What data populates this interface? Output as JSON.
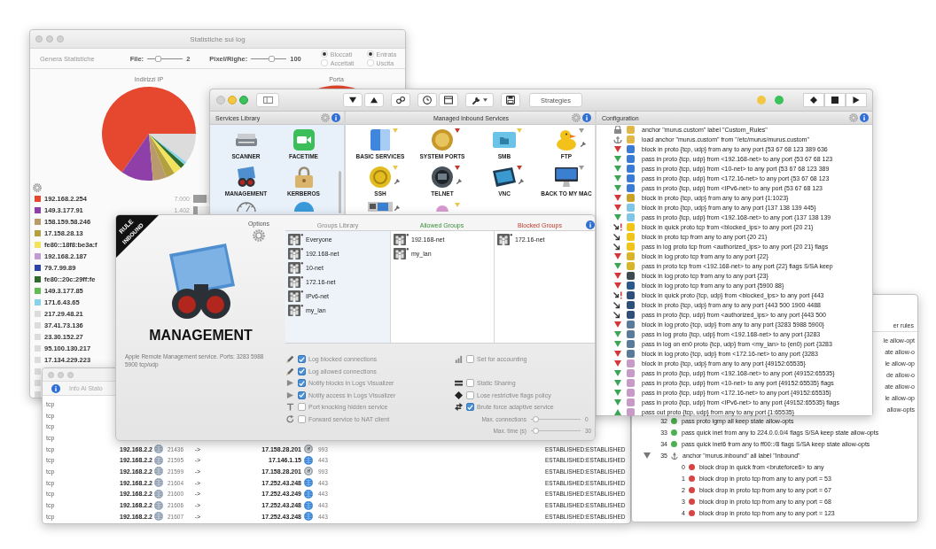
{
  "stats_window": {
    "title": "Statistiche sui log",
    "generate_label": "Genera Statistiche",
    "sliders": [
      {
        "label": "File:",
        "level": 0.27,
        "value": "2"
      },
      {
        "label": "Pixel/Righe:",
        "level": 0.6,
        "value": "100"
      }
    ],
    "radio_groups": [
      [
        {
          "label": "Bloccati",
          "selected": true
        },
        {
          "label": "Accettati",
          "selected": false
        }
      ],
      [
        {
          "label": "Entrata",
          "selected": true
        },
        {
          "label": "Uscita",
          "selected": false
        }
      ]
    ],
    "ip_chart": {
      "title": "Indirizzi IP"
    },
    "port_chart": {
      "title": "Porta"
    },
    "legend": [
      {
        "label": "192.168.2.254",
        "color": "#e5472f",
        "value": "7.000",
        "level": 0.85
      },
      {
        "label": "149.3.177.91",
        "color": "#8e3fa8",
        "value": "1.402",
        "level": 0.3
      },
      {
        "label": "158.159.58.246",
        "color": "#b89a6c"
      },
      {
        "label": "17.158.28.13",
        "color": "#b3a040"
      },
      {
        "label": "fe80::18f8:be3a:f",
        "color": "#f2e25c"
      },
      {
        "label": "192.168.2.187",
        "color": "#c39bd3"
      },
      {
        "label": "79.7.99.89",
        "color": "#2b44a6"
      },
      {
        "label": "fe80::20c:29ff:fe",
        "color": "#2e6b2e"
      },
      {
        "label": "149.3.177.85",
        "color": "#62bb55"
      },
      {
        "label": "171.6.43.65",
        "color": "#86d3e8"
      },
      {
        "label": "217.29.48.21",
        "color": "#dcdcdc"
      },
      {
        "label": "37.41.73.136",
        "color": "#dcdcdc"
      },
      {
        "label": "23.30.152.27",
        "color": "#dcdcdc"
      },
      {
        "label": "95.100.130.217",
        "color": "#dcdcdc"
      },
      {
        "label": "17.134.229.223",
        "color": "#dcdcdc"
      },
      {
        "color": "#dcdcdc"
      },
      {
        "color": "#dcdcdc"
      },
      {
        "color": "#dcdcdc"
      }
    ]
  },
  "main_window": {
    "toolbar": {
      "strategies_label": "Strategies"
    },
    "status_lights": [
      {
        "color": "#f2c744"
      },
      {
        "color": "#3cc25a"
      }
    ],
    "services_library": {
      "title": "Services Library",
      "items": [
        {
          "label": "SCANNER"
        },
        {
          "label": "FACETIME"
        },
        {
          "label": "MANAGEMENT"
        },
        {
          "label": "KERBEROS"
        }
      ]
    },
    "managed_services": {
      "title": "Managed Inbound Services",
      "items": [
        {
          "label": "BASIC SERVICES",
          "color": "#e9c84f"
        },
        {
          "label": "SYSTEM PORTS",
          "color": "#c0392b"
        },
        {
          "label": "SMB",
          "color": "#e9c84f"
        },
        {
          "label": "FTP",
          "color": "#9a9a9a",
          "configured": true
        },
        {
          "label": "SSH",
          "color": "#e9c84f",
          "configured": true
        },
        {
          "label": "TELNET",
          "color": "#c0392b",
          "configured": true
        },
        {
          "label": "VNC",
          "color": "#c0392b",
          "configured": true
        },
        {
          "label": "BACK TO MY MAC",
          "color": "#9a9a9a"
        },
        {
          "configured": true
        },
        {
          "color": "#e9c84f"
        }
      ]
    },
    "configuration": {
      "title": "Configuration",
      "lines": [
        {
          "kind": "lock",
          "color": "#e0b84a",
          "text": "anchor \"murus.custom\" label \"Custom_Rules\""
        },
        {
          "kind": "anchor",
          "color": "#e0b84a",
          "text": "load anchor \"murus.custom\" from \"/etc/murus/murus.custom\""
        },
        {
          "kind": "block",
          "color": "#3a7bd5",
          "text": "block in proto {tcp, udp} from any to any port {53 67 68 123 389 636"
        },
        {
          "kind": "pass",
          "color": "#3a7bd5",
          "text": "pass in proto {tcp, udp} from <192.168-net> to any port {53 67 68 123"
        },
        {
          "kind": "pass",
          "color": "#3a7bd5",
          "text": "pass in proto {tcp, udp} from <10-net> to any port {53 67 68 123 389"
        },
        {
          "kind": "pass",
          "color": "#3a7bd5",
          "text": "pass in proto {tcp, udp} from <172.16-net> to any port {53 67 68 123"
        },
        {
          "kind": "pass",
          "color": "#3a7bd5",
          "text": "pass in proto {tcp, udp} from <IPv6-net> to any port {53 67 68 123"
        },
        {
          "kind": "block",
          "color": "#c9a227",
          "text": "block in proto {tcp, udp} from any to any port {1:1023}"
        },
        {
          "kind": "block",
          "color": "#7fc6e6",
          "text": "block in proto {tcp, udp} from any to any port {137 138 139 445}"
        },
        {
          "kind": "pass",
          "color": "#7fc6e6",
          "text": "pass in proto {tcp, udp} from <192.168-net> to any port {137 138 139"
        },
        {
          "kind": "quick",
          "color": "#f0c419",
          "text": "block in quick proto tcp from <blocked_ips> to any port {20 21}"
        },
        {
          "kind": "arrow",
          "color": "#f0c419",
          "text": "block in proto tcp from any to any port {20 21}"
        },
        {
          "kind": "arrow",
          "color": "#f0c419",
          "text": "pass in log proto tcp from <authorized_ips> to any port {20 21} flags"
        },
        {
          "kind": "block",
          "color": "#d8b42a",
          "text": "block in log proto tcp from any to any port {22}"
        },
        {
          "kind": "pass",
          "color": "#d8b42a",
          "text": "pass in proto tcp from <192.168-net> to any port {22} flags S/SA keep"
        },
        {
          "kind": "block",
          "color": "#3c4a52",
          "text": "block in log proto tcp from any to any port {23}"
        },
        {
          "kind": "block",
          "color": "#2b5a8a",
          "text": "block in log proto tcp from any to any port {5900 88}"
        },
        {
          "kind": "quick",
          "color": "#2e4f7a",
          "text": "block in quick proto {tcp, udp} from <blocked_ips> to any port {443"
        },
        {
          "kind": "arrow",
          "color": "#2e4f7a",
          "text": "block in proto {tcp, udp} from any to any port {443 500 1900 4488"
        },
        {
          "kind": "arrow",
          "color": "#2e4f7a",
          "text": "pass in proto {tcp, udp} from <authorized_ips> to any port {443 500"
        },
        {
          "kind": "block",
          "color": "#5a7a9a",
          "text": "block in log proto {tcp, udp} from any to any port {3283 5988 5900}"
        },
        {
          "kind": "pass",
          "color": "#5a7a9a",
          "text": "pass in log proto {tcp, udp} from <192.168-net> to any port {3283"
        },
        {
          "kind": "pass",
          "color": "#5a7a9a",
          "text": "pass in log on en0 proto {tcp, udp} from <my_lan> to (en0) port {3283"
        },
        {
          "kind": "block",
          "color": "#5a7a9a",
          "text": "block in log proto {tcp, udp} from <172.16-net> to any port {3283"
        },
        {
          "kind": "block",
          "color": "#c89ac8",
          "text": "block in proto {tcp, udp} from any to any port {49152:65535}"
        },
        {
          "kind": "pass",
          "color": "#c89ac8",
          "text": "pass in proto {tcp, udp} from <192.168-net> to any port {49152:65535}"
        },
        {
          "kind": "pass",
          "color": "#c89ac8",
          "text": "pass in proto {tcp, udp} from <10-net> to any port {49152:65535} flags"
        },
        {
          "kind": "pass",
          "color": "#c89ac8",
          "text": "pass in proto {tcp, udp} from <172.16-net> to any port {49152:65535}"
        },
        {
          "kind": "pass",
          "color": "#c89ac8",
          "text": "pass in proto {tcp, udp} from <IPv6-net> to any port {49152:65535} flags"
        },
        {
          "kind": "out",
          "color": "#c89ac8",
          "text": "pass out proto {tcp, udp} from any to any port {1:65535}"
        }
      ]
    }
  },
  "service_dialog": {
    "ribbon": [
      "RULE",
      "INBOUND"
    ],
    "options_label": "Options",
    "name": "MANAGEMENT",
    "description": "Apple Remote Management service. Ports: 3283 5988 5900 tcp/udp",
    "groups_library": {
      "title": "Groups Library",
      "items": [
        "Everyone",
        "192.168-net",
        "10-net",
        "172.16-net",
        "IPv6-net",
        "my_lan"
      ]
    },
    "allowed_groups": {
      "title": "Allowed Groups",
      "items": [
        "192.168-net",
        "my_lan"
      ]
    },
    "blocked_groups": {
      "title": "Blocked Groups",
      "items": [
        "172.16-net"
      ]
    },
    "left_options": [
      {
        "label": "Log blocked connections",
        "checked": true
      },
      {
        "label": "Log allowed connections",
        "checked": true
      },
      {
        "label": "Notify blocks in Logs Visualizer",
        "checked": true
      },
      {
        "label": "Notify access in Logs Visualizer",
        "checked": true
      },
      {
        "label": "Port knocking hidden service",
        "checked": false
      },
      {
        "label": "Forward service to NAT client",
        "checked": false
      }
    ],
    "right_options": [
      {
        "kind": "checkbox",
        "label": "Set for accounting",
        "checked": false
      },
      {
        "kind": "checkbox",
        "label": "Static Sharing",
        "checked": false
      },
      {
        "kind": "checkbox",
        "label": "Lose restrictive flags policy",
        "checked": false
      },
      {
        "kind": "checkbox",
        "label": "Brute force adaptive service",
        "checked": true
      },
      {
        "kind": "slider",
        "label": "Max. connections",
        "level": 0.05,
        "value": "0"
      },
      {
        "kind": "slider",
        "label": "Max. time (s)",
        "level": 0.05,
        "value": "30"
      }
    ]
  },
  "connections_window": {
    "info_text": "Info Al Stato",
    "rows": [
      {
        "protocol": "tcp"
      },
      {
        "protocol": "tcp"
      },
      {
        "protocol": "tcp"
      },
      {
        "protocol": "tcp"
      },
      {
        "protocol": "tcp",
        "source": "192.168.2.2",
        "source_port": "21436",
        "direction": "->",
        "destination": "17.158.28.201",
        "kind": "dial",
        "destination_port": "993",
        "state": "ESTABLISHED:ESTABLISHED"
      },
      {
        "protocol": "tcp",
        "source": "192.168.2.2",
        "source_port": "21595",
        "direction": "->",
        "destination": "17.146.1.15",
        "kind": "globe",
        "destination_port": "443",
        "state": "ESTABLISHED:ESTABLISHED"
      },
      {
        "protocol": "tcp",
        "source": "192.168.2.2",
        "source_port": "21599",
        "direction": "->",
        "destination": "17.158.28.201",
        "kind": "dial",
        "destination_port": "993",
        "state": "ESTABLISHED:ESTABLISHED"
      },
      {
        "protocol": "tcp",
        "source": "192.168.2.2",
        "source_port": "21604",
        "direction": "->",
        "destination": "17.252.43.248",
        "kind": "globe",
        "destination_port": "443",
        "state": "ESTABLISHED:ESTABLISHED"
      },
      {
        "protocol": "tcp",
        "source": "192.168.2.2",
        "source_port": "21600",
        "direction": "->",
        "destination": "17.252.43.249",
        "kind": "globe",
        "destination_port": "443",
        "state": "ESTABLISHED:ESTABLISHED"
      },
      {
        "protocol": "tcp",
        "source": "192.168.2.2",
        "source_port": "21606",
        "direction": "->",
        "destination": "17.252.43.248",
        "kind": "globe",
        "destination_port": "443",
        "state": "ESTABLISHED:ESTABLISHED"
      },
      {
        "protocol": "tcp",
        "source": "192.168.2.2",
        "source_port": "21607",
        "direction": "->",
        "destination": "17.252.43.248",
        "kind": "globe",
        "destination_port": "443",
        "state": "ESTABLISHED:ESTABLISHED"
      }
    ]
  },
  "rules_window": {
    "header_fragment": "er rules",
    "fragments": [
      "le allow-opt",
      "ate allow-o",
      "le allow-op",
      "de allow-o",
      "ate allow-o",
      "le allow-op",
      "allow-opts"
    ],
    "rules": [
      {
        "number": "32",
        "kind": "rule",
        "color": "#4caf50",
        "text": "pass proto igmp all keep state allow-opts"
      },
      {
        "number": "33",
        "kind": "rule",
        "color": "#4caf50",
        "text": "pass quick inet from any to 224.0.0.0/4 flags S/SA keep state allow-opts"
      },
      {
        "number": "34",
        "kind": "rule",
        "color": "#4caf50",
        "text": "pass quick inet6 from any to ff00::/8 flags S/SA keep state allow-opts"
      },
      {
        "number": "35",
        "kind": "anchor",
        "expanded": true,
        "text": "anchor \"murus.inbound\" all label \"Inbound\"",
        "children": [
          {
            "number": "0",
            "kind": "rule",
            "color": "#d64541",
            "text": "block drop in quick from <bruteforce6> to any"
          },
          {
            "number": "1",
            "kind": "rule",
            "color": "#d64541",
            "text": "block drop in proto tcp from any to any port = 53"
          },
          {
            "number": "2",
            "kind": "rule",
            "color": "#d64541",
            "text": "block drop in proto tcp from any to any port = 67"
          },
          {
            "number": "3",
            "kind": "rule",
            "color": "#d64541",
            "text": "block drop in proto tcp from any to any port = 68"
          },
          {
            "number": "4",
            "kind": "rule",
            "color": "#d64541",
            "text": "block drop in proto tcp from any to any port = 123"
          }
        ]
      }
    ]
  }
}
